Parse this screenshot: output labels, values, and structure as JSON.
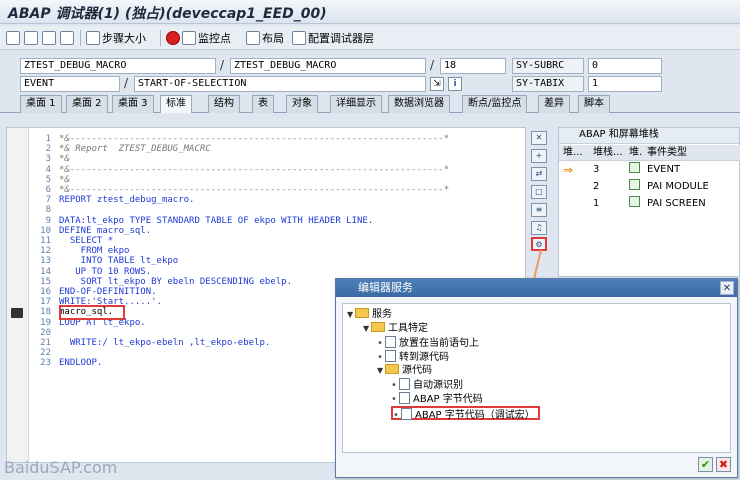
{
  "window": {
    "title": "ABAP 调试器(1) (独占)(deveccap1_EED_00)"
  },
  "toolbar": {
    "step_size": "步骤大小",
    "watchpoint": "监控点",
    "layout": "布局",
    "config_layer": "配置调试器层"
  },
  "status": {
    "program": "ZTEST_DEBUG_MACRO",
    "include": "ZTEST_DEBUG_MACRO",
    "line": "18",
    "event_type": "EVENT",
    "event": "START-OF-SELECTION",
    "subrc_label": "SY-SUBRC",
    "subrc_value": "0",
    "tabix_label": "SY-TABIX",
    "tabix_value": "1"
  },
  "tabs": [
    "桌面 1",
    "桌面 2",
    "桌面 3",
    "标准",
    "结构",
    "表",
    "对象",
    "详细显示",
    "数据浏览器",
    "断点/监控点",
    "差异",
    "脚本"
  ],
  "code_lines": [
    {
      "n": "1",
      "t": "*&---------------------------------------------------------------------*",
      "c": "cm"
    },
    {
      "n": "2",
      "t": "*& Report  ZTEST_DEBUG_MACRC",
      "c": "cm"
    },
    {
      "n": "3",
      "t": "*&",
      "c": "cm"
    },
    {
      "n": "4",
      "t": "*&---------------------------------------------------------------------*",
      "c": "cm"
    },
    {
      "n": "5",
      "t": "*&",
      "c": "cm"
    },
    {
      "n": "6",
      "t": "*&---------------------------------------------------------------------*",
      "c": "cm"
    },
    {
      "n": "7",
      "t": "REPORT ztest_debug_macro.",
      "c": "kw"
    },
    {
      "n": "8",
      "t": "",
      "c": ""
    },
    {
      "n": "9",
      "t": "DATA:lt_ekpo TYPE STANDARD TABLE OF ekpo WITH HEADER LINE.",
      "c": "kw"
    },
    {
      "n": "10",
      "t": "DEFINE macro_sql.",
      "c": "kw"
    },
    {
      "n": "11",
      "t": "  SELECT *",
      "c": "kw"
    },
    {
      "n": "12",
      "t": "    FROM ekpo",
      "c": "kw"
    },
    {
      "n": "13",
      "t": "    INTO TABLE lt_ekpo",
      "c": "kw"
    },
    {
      "n": "14",
      "t": "   UP TO 10 ROWS.",
      "c": "kw"
    },
    {
      "n": "15",
      "t": "    SORT lt_ekpo BY ebeln DESCENDING ebelp.",
      "c": "kw"
    },
    {
      "n": "16",
      "t": "END-OF-DEFINITION.",
      "c": "kw"
    },
    {
      "n": "17",
      "t": "WRITE:'Start.....'.",
      "c": "kw"
    },
    {
      "n": "18",
      "t": "macro_sql.",
      "c": ""
    },
    {
      "n": "19",
      "t": "LOOP AT lt_ekpo.",
      "c": "kw"
    },
    {
      "n": "20",
      "t": "",
      "c": ""
    },
    {
      "n": "21",
      "t": "  WRITE:/ lt_ekpo-ebeln ,lt_ekpo-ebelp.",
      "c": "kw"
    },
    {
      "n": "22",
      "t": "",
      "c": ""
    },
    {
      "n": "23",
      "t": "ENDLOOP.",
      "c": "kw"
    }
  ],
  "stack": {
    "title": "ABAP 和屏幕堆栈",
    "col_stack": "堆...",
    "col_level": "堆栈...",
    "col_type_short": "堆.",
    "col_event": "事件类型",
    "rows": [
      {
        "level": "3",
        "event": "EVENT",
        "current": true
      },
      {
        "level": "2",
        "event": "PAI MODULE",
        "current": false
      },
      {
        "level": "1",
        "event": "PAI SCREEN",
        "current": false
      }
    ]
  },
  "dialog": {
    "title": "编辑器服务",
    "root": "服务",
    "group1": "工具特定",
    "item_set_current": "放置在当前语句上",
    "item_goto_source": "转到源代码",
    "group2": "源代码",
    "item_auto_detect": "自动源识别",
    "item_bytecode": "ABAP 字节代码",
    "item_bytecode_macro": "ABAP 字节代码（调试宏）"
  },
  "watermark": "BaiduSAP.com"
}
